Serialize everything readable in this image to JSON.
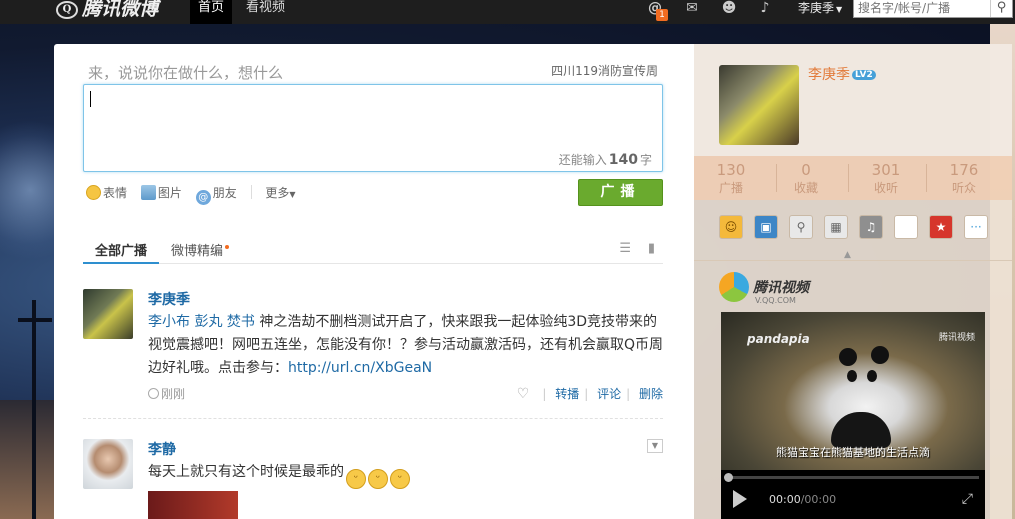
{
  "topbar": {
    "logo_text": "腾讯微博",
    "logo_mark": "Q",
    "nav": [
      "首页",
      "看视频"
    ],
    "at_badge": "1",
    "username": "李庚季",
    "search_placeholder": "搜名字/帐号/广播",
    "icons": [
      "at-icon",
      "mail-icon",
      "user-icon",
      "sound-icon",
      "search-icon"
    ]
  },
  "composer": {
    "prompt": "来，说说你在做什么，想什么",
    "topic": "四川119消防宣传周",
    "remaining_prefix": "还能输入",
    "remaining_count": "140",
    "remaining_suffix": "字",
    "tools": [
      "表情",
      "图片",
      "朋友",
      "更多"
    ],
    "post_button": "广播"
  },
  "tabs": {
    "all": "全部广播",
    "digest": "微博精编"
  },
  "feed": [
    {
      "author": "李庚季",
      "mentions": "李小布 彭丸 焚书",
      "text": " 神之浩劫不删档测试开启了，快来跟我一起体验纯3D竞技带来的视觉震撼吧！网吧五连坐，怎能没有你！？参与活动赢激活码，还有机会赢取Q币周边好礼哦。点击参与：",
      "link": "http://url.cn/XbGeaN",
      "time": "刚刚",
      "actions": [
        "转播",
        "评论",
        "删除"
      ]
    },
    {
      "author": "李静",
      "text": "每天上就只有这个时候是最乖的"
    }
  ],
  "sidebar": {
    "name": "李庚季",
    "level": "LV2",
    "stats": [
      {
        "num": "130",
        "label": "广播"
      },
      {
        "num": "0",
        "label": "收藏"
      },
      {
        "num": "301",
        "label": "收听"
      },
      {
        "num": "176",
        "label": "听众"
      }
    ],
    "video_brand": "腾讯视频",
    "video_sub": "V.QQ.COM",
    "video": {
      "watermark_left": "pandapia",
      "watermark_right": "腾讯视频",
      "subtitle": "熊猫宝宝在熊猫基地的生活点滴",
      "current": "00:00",
      "duration": "00:00"
    }
  }
}
